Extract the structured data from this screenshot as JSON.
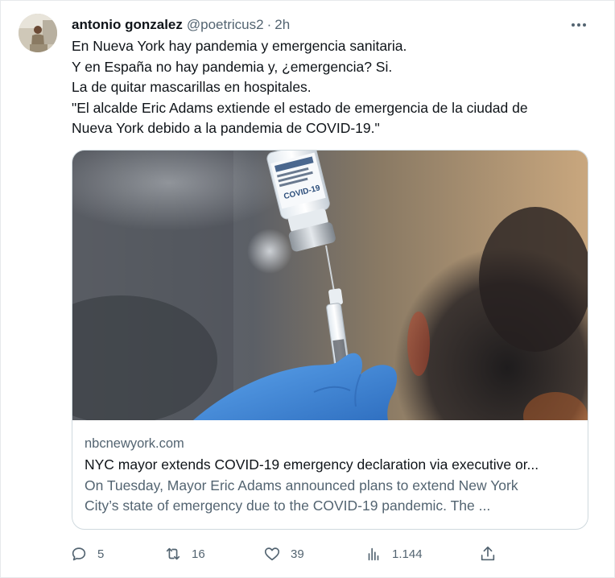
{
  "tweet": {
    "author_name": "antonio gonzalez",
    "author_handle": "@poetricus2",
    "separator": "·",
    "time": "2h",
    "text_lines": [
      "En Nueva York hay pandemia y emergencia sanitaria.",
      "Y en España no hay pandemia y, ¿emergencia? Si.",
      "La de quitar mascarillas en hospitales.",
      "\"El alcalde Eric Adams extiende el estado de emergencia de la ciudad de",
      "Nueva York debido a la pandemia de COVID-19.\""
    ]
  },
  "card": {
    "domain": "nbcnewyork.com",
    "title": "NYC mayor extends COVID-19 emergency declaration via executive or...",
    "description_lines": [
      "On Tuesday, Mayor Eric Adams announced plans to extend New York",
      "City’s state of emergency due to the COVID-19 pandemic. The ..."
    ],
    "vial_label": "COVID-19"
  },
  "actions": {
    "replies": "5",
    "retweets": "16",
    "likes": "39",
    "views": "1.144"
  },
  "icons": {
    "more": "more-horizontal-icon",
    "reply": "reply-icon",
    "retweet": "retweet-icon",
    "like": "heart-icon",
    "views": "analytics-icon",
    "share": "share-icon"
  },
  "colors": {
    "text_primary": "#0f1419",
    "text_secondary": "#536471",
    "border": "#cfd9de",
    "glove_blue": "#4a8fd8"
  }
}
